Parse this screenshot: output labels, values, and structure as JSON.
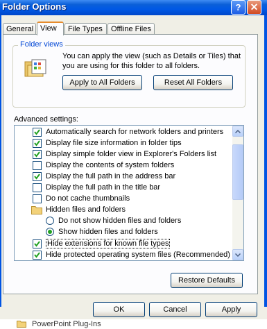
{
  "window": {
    "title": "Folder Options",
    "help_glyph": "?",
    "close_glyph": "✕"
  },
  "tabs": [
    {
      "label": "General",
      "active": false
    },
    {
      "label": "View",
      "active": true
    },
    {
      "label": "File Types",
      "active": false
    },
    {
      "label": "Offline Files",
      "active": false
    }
  ],
  "folder_views": {
    "title": "Folder views",
    "description": "You can apply the view (such as Details or Tiles) that you are using for this folder to all folders.",
    "apply_button": "Apply to All Folders",
    "reset_button": "Reset All Folders"
  },
  "advanced": {
    "label": "Advanced settings:",
    "items": [
      {
        "type": "checkbox",
        "label": "Automatically search for network folders and printers",
        "checked": true,
        "indent": 0
      },
      {
        "type": "checkbox",
        "label": "Display file size information in folder tips",
        "checked": true,
        "indent": 0
      },
      {
        "type": "checkbox",
        "label": "Display simple folder view in Explorer's Folders list",
        "checked": true,
        "indent": 0
      },
      {
        "type": "checkbox",
        "label": "Display the contents of system folders",
        "checked": false,
        "indent": 0
      },
      {
        "type": "checkbox",
        "label": "Display the full path in the address bar",
        "checked": true,
        "indent": 0
      },
      {
        "type": "checkbox",
        "label": "Display the full path in the title bar",
        "checked": false,
        "indent": 0
      },
      {
        "type": "checkbox",
        "label": "Do not cache thumbnails",
        "checked": false,
        "indent": 0
      },
      {
        "type": "folder",
        "label": "Hidden files and folders",
        "indent": 0
      },
      {
        "type": "radio",
        "label": "Do not show hidden files and folders",
        "checked": false,
        "indent": 1
      },
      {
        "type": "radio",
        "label": "Show hidden files and folders",
        "checked": true,
        "indent": 1
      },
      {
        "type": "checkbox",
        "label": "Hide extensions for known file types",
        "checked": true,
        "indent": 0,
        "focused": true
      },
      {
        "type": "checkbox",
        "label": "Hide protected operating system files (Recommended)",
        "checked": true,
        "indent": 0
      }
    ]
  },
  "buttons": {
    "restore_defaults": "Restore Defaults",
    "ok": "OK",
    "cancel": "Cancel",
    "apply": "Apply"
  },
  "background_text": "PowerPoint Plug-Ins"
}
